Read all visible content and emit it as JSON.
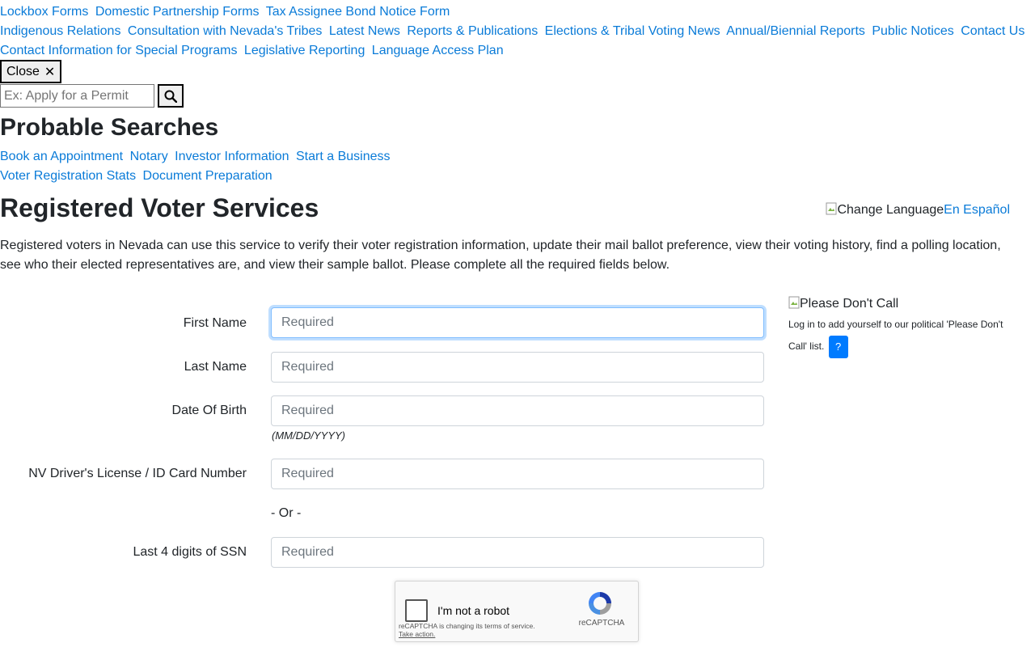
{
  "nav": {
    "rows": [
      [
        "Lockbox Forms",
        "Domestic Partnership Forms",
        "Tax Assignee Bond Notice Form"
      ],
      [
        "Indigenous Relations",
        "Consultation with Nevada's Tribes",
        "Latest News",
        "Reports & Publications",
        "Elections & Tribal Voting News",
        "Annual/Biennial Reports",
        "Public Notices",
        "Contact Us"
      ],
      [
        "Contact Information for Special Programs",
        "Legislative Reporting",
        "Language Access Plan"
      ]
    ]
  },
  "search": {
    "close_label": "Close",
    "close_glyph": "✕",
    "placeholder": "Ex: Apply for a Permit",
    "icon": "search-icon"
  },
  "probable": {
    "title": "Probable Searches",
    "links_row1": [
      "Book an Appointment",
      "Notary",
      "Investor Information",
      "Start a Business"
    ],
    "links_row2": [
      "Voter Registration Stats",
      "Document Preparation"
    ]
  },
  "page": {
    "title": "Registered Voter Services",
    "intro": "Registered voters in Nevada can use this service to verify their voter registration information, update their mail ballot preference, view their voting history, find a polling location, see who their elected representatives are, and view their sample ballot. Please complete all the required fields below."
  },
  "language": {
    "image_alt": "Change Language",
    "link": "En Español"
  },
  "form": {
    "first_name": {
      "label": "First Name",
      "placeholder": "Required"
    },
    "last_name": {
      "label": "Last Name",
      "placeholder": "Required"
    },
    "dob": {
      "label": "Date Of Birth",
      "placeholder": "Required",
      "hint": "(MM/DD/YYYY)"
    },
    "license": {
      "label": "NV Driver's License / ID Card Number",
      "placeholder": "Required"
    },
    "or": "- Or -",
    "ssn": {
      "label": "Last 4 digits of SSN",
      "placeholder": "Required"
    }
  },
  "captcha": {
    "label": "I'm not a robot",
    "notice": "reCAPTCHA is changing its terms of service.",
    "take_action": "Take action.",
    "brand": "reCAPTCHA"
  },
  "dont_call": {
    "image_alt": "Please Don't Call",
    "text": "Log in to add yourself to our political 'Please Don't Call' list.",
    "help": "?"
  },
  "colors": {
    "link": "#0a7bd8",
    "focus_border": "#80bdff",
    "help_button": "#007bff"
  }
}
